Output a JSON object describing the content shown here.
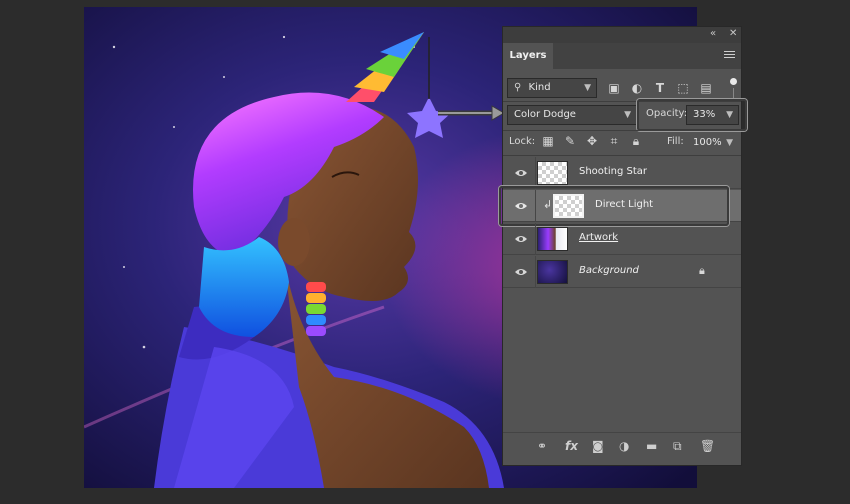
{
  "panel": {
    "collapse_glyph": "«",
    "close_glyph": "✕",
    "tab_label": "Layers",
    "menu_icon": "panel-menu-icon"
  },
  "filter": {
    "kind_icon": "search-icon",
    "kind_label": "Kind",
    "filter_icons": [
      "image-filter-icon",
      "adjustment-filter-icon",
      "type-filter-icon",
      "shape-filter-icon",
      "smart-object-filter-icon"
    ],
    "type_glyph": "T"
  },
  "blend": {
    "mode": "Color Dodge",
    "opacity_label": "Opacity:",
    "opacity_value": "33%"
  },
  "lock": {
    "label": "Lock:",
    "fill_label": "Fill:",
    "fill_value": "100%"
  },
  "layers": [
    {
      "name": "Shooting Star",
      "visible": true,
      "selected": false,
      "thumbnail": "transparent"
    },
    {
      "name": "Direct Light",
      "visible": true,
      "selected": true,
      "clipped": true,
      "thumbnail": "transparent"
    },
    {
      "name": "Artwork",
      "visible": true,
      "selected": false,
      "linked": true,
      "thumbnail": "artwork"
    },
    {
      "name": "Background",
      "visible": true,
      "selected": false,
      "locked": true,
      "thumbnail": "space"
    }
  ],
  "footer": {
    "fx_label": "fx",
    "icons": [
      "link-layers-icon",
      "fx-icon",
      "add-mask-icon",
      "adjustment-layer-icon",
      "new-group-icon",
      "new-layer-icon",
      "trash-icon"
    ]
  },
  "colors": {
    "panel_bg": "#535353",
    "selected_row": "#6e6e6e",
    "space_purple": "#2a1f6e",
    "hair_pink": "#e04fff",
    "hair_blue": "#1e9bff",
    "skin": "#6b4228"
  }
}
